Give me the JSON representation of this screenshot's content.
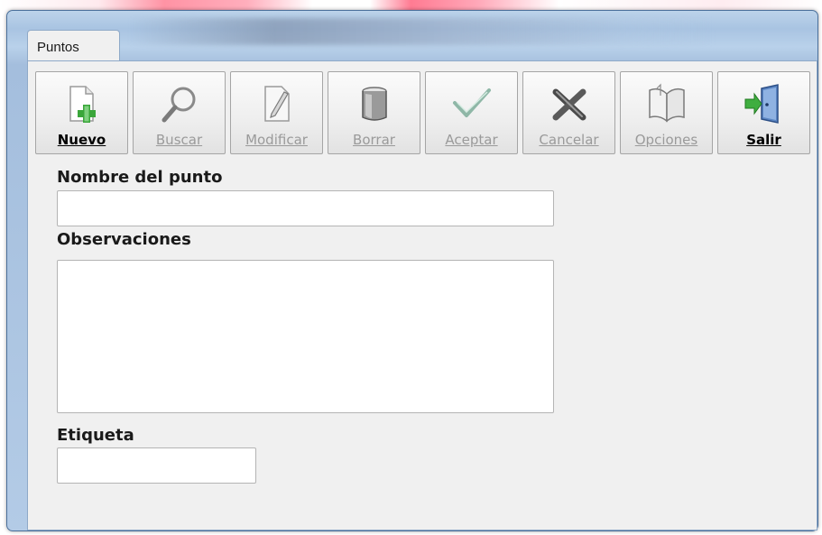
{
  "window": {
    "title": "Puntos"
  },
  "toolbar": {
    "buttons": [
      {
        "label": "Nuevo",
        "icon": "new-document-icon",
        "enabled": true
      },
      {
        "label": "Buscar",
        "icon": "magnifier-icon",
        "enabled": false
      },
      {
        "label": "Modificar",
        "icon": "edit-document-icon",
        "enabled": false
      },
      {
        "label": "Borrar",
        "icon": "trash-bin-icon",
        "enabled": false
      },
      {
        "label": "Aceptar",
        "icon": "checkmark-icon",
        "enabled": false
      },
      {
        "label": "Cancelar",
        "icon": "cancel-x-icon",
        "enabled": false
      },
      {
        "label": "Opciones",
        "icon": "open-book-icon",
        "enabled": false
      },
      {
        "label": "Salir",
        "icon": "exit-door-icon",
        "enabled": true
      }
    ]
  },
  "form": {
    "nombre": {
      "label": "Nombre del punto",
      "value": ""
    },
    "observaciones": {
      "label": "Observaciones",
      "value": ""
    },
    "etiqueta": {
      "label": "Etiqueta",
      "value": ""
    }
  }
}
